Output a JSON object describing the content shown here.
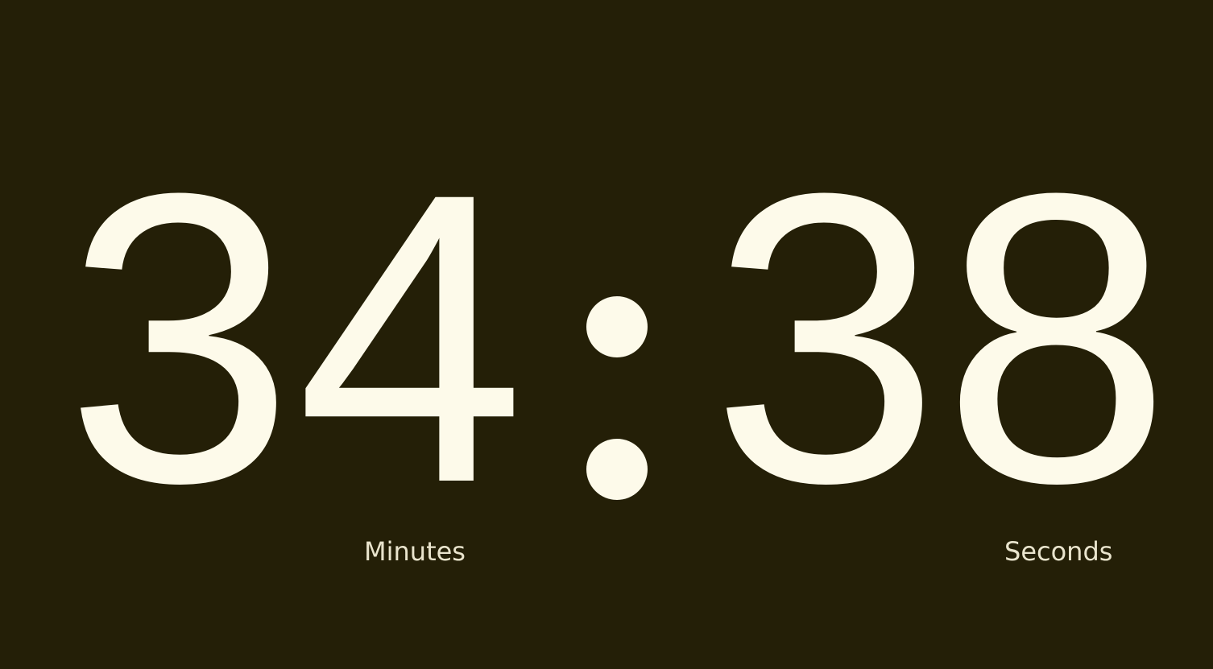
{
  "timer": {
    "minutes": [
      "3",
      "4"
    ],
    "seconds": [
      "3",
      "8"
    ],
    "separator": ":",
    "minutes_label": "Minutes",
    "seconds_label": "Seconds"
  },
  "colors": {
    "background": "#241f07",
    "digit": "#fdfaea",
    "label": "#e9e4cd"
  }
}
